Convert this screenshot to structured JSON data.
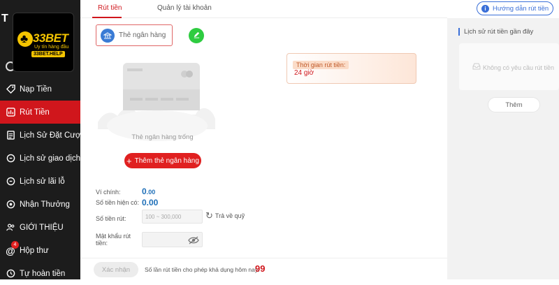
{
  "brand": {
    "name": "33BET",
    "tagline": "Uy tín hàng đầu",
    "site": "33BET.HELP",
    "accent": "#d0161c",
    "gold": "#f4c400"
  },
  "sidebar": {
    "partial_letter": "T",
    "items": [
      {
        "label": "Nạp Tiền",
        "icon": "tag-icon",
        "active": false
      },
      {
        "label": "Rút Tiền",
        "icon": "withdraw-icon",
        "active": true
      },
      {
        "label": "Lịch Sử Đặt Cược",
        "icon": "clipboard-icon",
        "active": false
      },
      {
        "label": "Lịch sử giao dịch",
        "icon": "history-icon",
        "active": false
      },
      {
        "label": "Lịch sử lãi lỗ",
        "icon": "history-icon",
        "active": false
      },
      {
        "label": "Nhận Thưởng",
        "icon": "gift-icon",
        "active": false
      },
      {
        "label": "GIỚI THIỆU",
        "icon": "users-icon",
        "active": false
      },
      {
        "label": "Hộp thư",
        "icon": "at-icon",
        "active": false,
        "badge": "4"
      },
      {
        "label": "Tự hoàn tiền",
        "icon": "refund-icon",
        "active": false
      }
    ]
  },
  "tabs": [
    {
      "label": "Rút tiền",
      "active": true
    },
    {
      "label": "Quản lý tài khoản",
      "active": false
    }
  ],
  "guide_button": "Hướng dẫn rút tiền",
  "bank": {
    "chip_label": "Thẻ ngân hàng",
    "empty_text": "Thẻ ngân hàng trống",
    "add_button": "Thêm thẻ ngân hàng"
  },
  "withdraw_time": {
    "label": "Thời gian rút tiền:",
    "value": "24 giờ"
  },
  "form": {
    "wallet_label": "Ví chính:",
    "wallet_value": "0",
    "wallet_decimals": ".00",
    "balance_label": "Số tiền hiện có:",
    "balance_value": "0.00",
    "amount_label": "Số tiền rút:",
    "amount_placeholder": "100 ~ 300,000",
    "refund_label": "Trả về quỹ",
    "password_label_1": "Mật khẩu rút",
    "password_label_2": "tiền:"
  },
  "footer": {
    "confirm_button": "Xác nhận",
    "limit_text": "Số lần rút tiền cho phép khả dụng hôm nay:",
    "limit_value": "99"
  },
  "history": {
    "title": "Lịch sử rút tiền gần đây",
    "empty_text": "Không có yêu cầu rút tiền",
    "more_button": "Thêm"
  }
}
